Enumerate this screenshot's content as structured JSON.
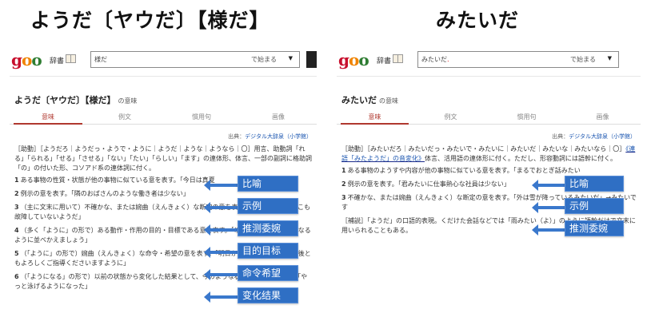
{
  "titles": {
    "left": "ようだ〔ヤウだ〕【様だ】",
    "right": "みたいだ"
  },
  "left": {
    "logo": "goo",
    "dict_label": "辞書",
    "search_value": "様だ",
    "search_mode": "で始まる",
    "caret": "▼",
    "word_title": "ようだ〔ヤウだ〕【様だ】",
    "word_suffix": "の意味",
    "tabs": [
      "意味",
      "例文",
      "慣用句",
      "画像"
    ],
    "source_prefix": "出典：",
    "source_name": "デジタル大辞泉（小学館）",
    "intro": "［助動］［ようだろ｜ようだっ・ようで・ように｜ようだ｜ような｜ようなら｜〇］用言、助動詞「れる」「られる」「せる」「させる」「ない」「たい」「らしい」「ます」の連体形、体言、一部の副詞に格助詞「の」の付いた形、コソアド系の連体詞に付く。",
    "items": [
      {
        "num": "1",
        "text": "ある事物の性質・状態が他の事物に似ている意を表す。「今日は真夏"
      },
      {
        "num": "2",
        "text": "例示の意を表す。「隣のおばさんのような働き者は少ない」"
      },
      {
        "num": "3",
        "text": "（主に文末に用いて）不確かな、または婉曲（えんきょく）な断定の意を表す。「どこも機械はどこも故障していないようだ」"
      },
      {
        "num": "4",
        "text": "（多く「ように」の形で）ある動作・作用の目的・目標である意を表す。「以前のような遅れなくなるように並べかえましょう」"
      },
      {
        "num": "5",
        "text": "（「ように」の形で）婉曲（えんきょく）な命令・希望の意を表す。「明日から手伝うように」「今後ともよろしくご指導くださいますように」"
      },
      {
        "num": "6",
        "text": "（「ようになる」の形で）以前の状態から変化した結果として、今のような状態になる意を表す。「やっと泳げるようになった」"
      }
    ],
    "callouts": [
      "比喻",
      "示例",
      "推测委婉",
      "目的目标",
      "命令希望",
      "变化结果"
    ]
  },
  "right": {
    "logo": "goo",
    "dict_label": "辞書",
    "search_value": "みたいだ",
    "search_mode": "で始まる",
    "caret": "▼",
    "word_title": "みたいだ",
    "word_suffix": "の意味",
    "tabs": [
      "意味",
      "例文",
      "慣用句",
      "画像"
    ],
    "source_prefix": "出典：",
    "source_name": "デジタル大辞泉（小学館）",
    "intro_a": "［助動］［みたいだろ｜みたいだっ・みたいで・みたいに｜みたいだ｜みたいな｜みたいなら｜〇］",
    "intro_link": "《連語「みたようだ」の音変化》",
    "intro_b": "体言、活用語の連体形に付く。ただし、形容動詞には語幹に付く。",
    "items": [
      {
        "num": "1",
        "text": "ある事物のようすや内容が他の事物に似ている意を表す。「まるでおとぎ話みたい"
      },
      {
        "num": "2",
        "text": "例示の意を表す。「君みたいに仕事熱心な社員は少ない」"
      },
      {
        "num": "3",
        "text": "不確かな、または婉曲（えんきょく）な断定の意を表す。「外は雪が降っているみたいだ」→みたいです"
      }
    ],
    "note": "［補説］「ようだ」の口語的表現。くだけた会話などでは「雨みたい（よ）」のように語幹だけで文末に用いられることもある。",
    "callouts": [
      "比喻",
      "示例",
      "推测委婉"
    ]
  }
}
